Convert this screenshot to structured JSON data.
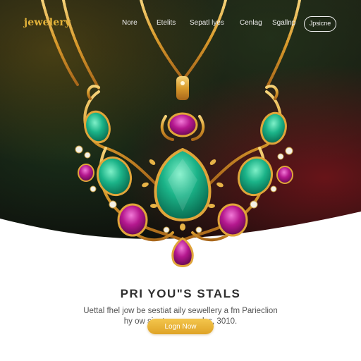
{
  "brand": {
    "logo_text": "jewelery"
  },
  "nav": {
    "links": [
      "Nore",
      "Etelits",
      "Sepatl lyes",
      "Cenlag",
      "Sgallnp"
    ],
    "pill_label": "Jpsicne"
  },
  "hero": {
    "headline": "PRI YOU\"S STALS",
    "subtext_line1": "Uettal fhel jow be sestiat aily sewellery a fm Parieclion",
    "subtext_line2": "hy ow siaat sme om elys, 3010.",
    "cta_label": "Logn Now"
  },
  "colors": {
    "gold": "#e3b33a",
    "emerald": "#16a37a",
    "amethyst": "#b0178c",
    "cta": "#e8b033"
  },
  "icons": [
    "necklace-image"
  ]
}
